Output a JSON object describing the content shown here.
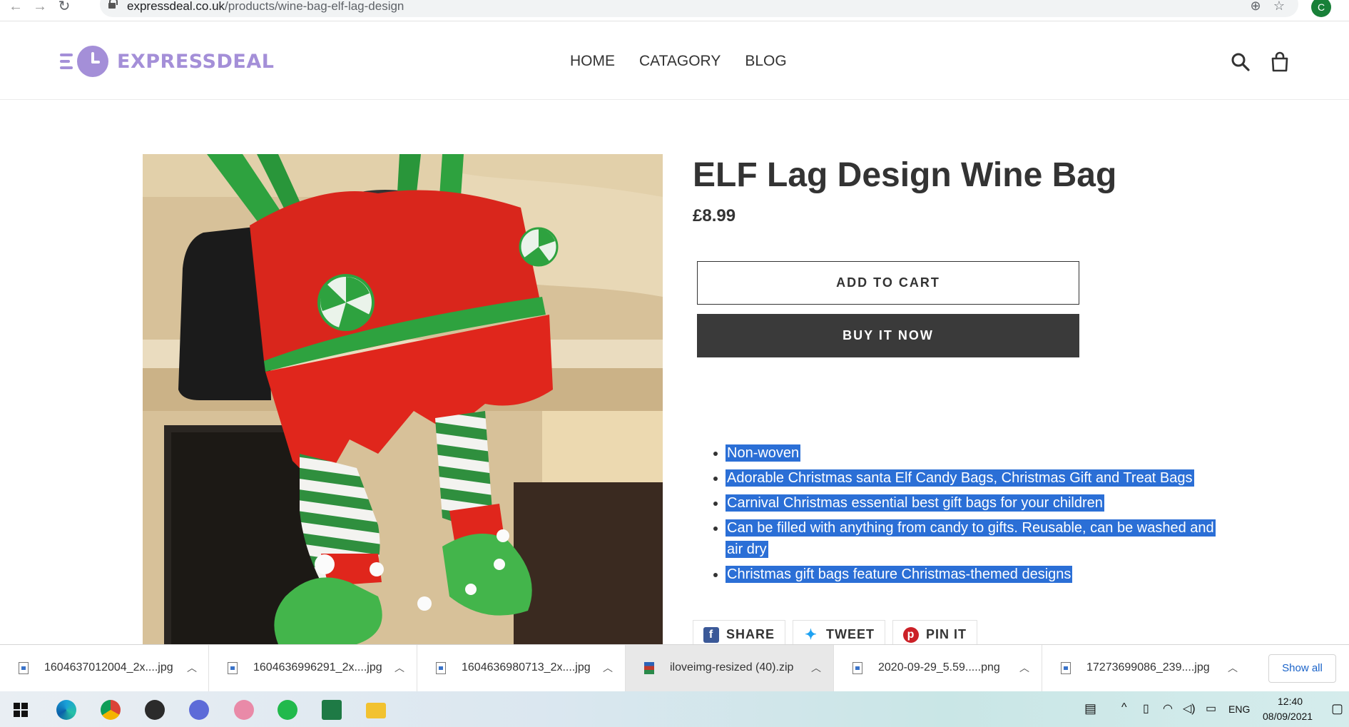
{
  "browser": {
    "url_domain": "expressdeal.co.uk",
    "url_path": "/products/wine-bag-elf-lag-design",
    "profile_initial": "C"
  },
  "header": {
    "logo_text": "EXPRESSDEAL",
    "nav": [
      "HOME",
      "CATAGORY",
      "BLOG"
    ]
  },
  "product": {
    "title": "ELF Lag Design Wine Bag",
    "price": "£8.99",
    "add_to_cart": "ADD TO CART",
    "buy_now": "BUY IT NOW",
    "features": [
      "Non-woven",
      "Adorable Christmas santa Elf Candy Bags, Christmas Gift and Treat Bags",
      "Carnival Christmas essential best gift bags for your children",
      "Can be filled with anything from candy to gifts. Reusable, can be washed and air dry",
      "Christmas gift bags feature Christmas-themed designs"
    ],
    "share": [
      {
        "label": "SHARE",
        "icon": "facebook-icon",
        "color": "#3b5998"
      },
      {
        "label": "TWEET",
        "icon": "twitter-icon",
        "color": "#1da1f2"
      },
      {
        "label": "PIN IT",
        "icon": "pinterest-icon",
        "color": "#cb2027"
      }
    ]
  },
  "downloads": {
    "items": [
      {
        "name": "1604637012004_2x....jpg",
        "type": "image"
      },
      {
        "name": "1604636996291_2x....jpg",
        "type": "image"
      },
      {
        "name": "1604636980713_2x....jpg",
        "type": "image"
      },
      {
        "name": "iloveimg-resized (40).zip",
        "type": "zip"
      },
      {
        "name": "2020-09-29_5.59.....png",
        "type": "image"
      },
      {
        "name": "17273699086_239....jpg",
        "type": "image"
      }
    ],
    "show_all": "Show all"
  },
  "taskbar": {
    "language": "ENG",
    "time": "12:40",
    "date": "08/09/2021"
  }
}
